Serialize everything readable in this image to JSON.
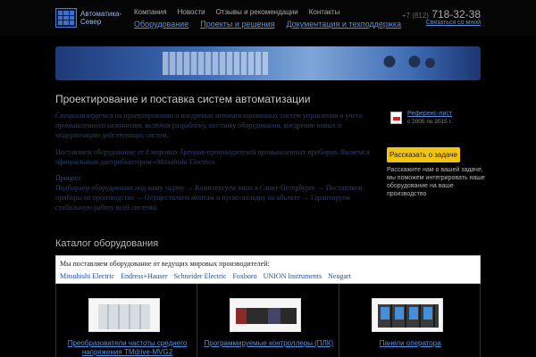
{
  "header": {
    "logo_text": "Автоматика-Север",
    "top_links": [
      "Компания",
      "Новости",
      "Отзывы и рекомендации",
      "Контакты"
    ],
    "main_links": [
      "Оборудование",
      "Проекты и решения",
      "Документация и техподдержка"
    ],
    "phone_prefix": "+7 (812)",
    "phone_number": "718-32-38",
    "contact_link": "Связаться со мной"
  },
  "main": {
    "title": "Проектирование и поставка систем автоматизации",
    "p1": "Специализируемся на проектировании и внедрении автоматизированных систем управления и учета промышленного назначения, включая разработку, поставку оборудования, внедрение новых и модернизацию действующих систем.",
    "p2": "Поставляем оборудование от 8 мировых брендов-производителей промышленных приборов. Являемся официальным дистрибьютором «Mitsubishi Electric».",
    "process_title": "Процесс",
    "process_text": "Подбираем оборудование под вашу задачу → Комплектуем заказ в Санкт-Петербурге → Поставляем приборы на производство → Осуществляем монтаж и пуско-наладку на объекте → Гарантируем стабильную работу всей системы"
  },
  "aside": {
    "ref_link": "Референс-лист",
    "ref_sub": "с 2005 по 2015 г.",
    "cta_button": "Рассказать о задаче",
    "cta_text": "Расскажите нам о вашей задаче, мы поможем интегрировать наше оборудование на ваше производство"
  },
  "catalog": {
    "title": "Каталог оборудования",
    "brands_label": "Мы поставляем оборудование от ведущих мировых производителей:",
    "brands": [
      "Mitsubishi Electric",
      "Endress+Hauser",
      "Schneider Electric",
      "Foxboro",
      "UNION Instruments",
      "Neugart"
    ],
    "cards": [
      {
        "label": "Преобразователи частоты среднего напряжения TMdrive-MVG2"
      },
      {
        "label": "Программируемые контроллеры (ПЛК)"
      },
      {
        "label": "Панели оператора"
      }
    ]
  },
  "colors": {
    "accent_link": "#5b8fd6",
    "cta": "#f2c310",
    "background": "#000000"
  },
  "icons": {
    "logo": "grid-logo-icon",
    "ref": "pdf-icon"
  }
}
